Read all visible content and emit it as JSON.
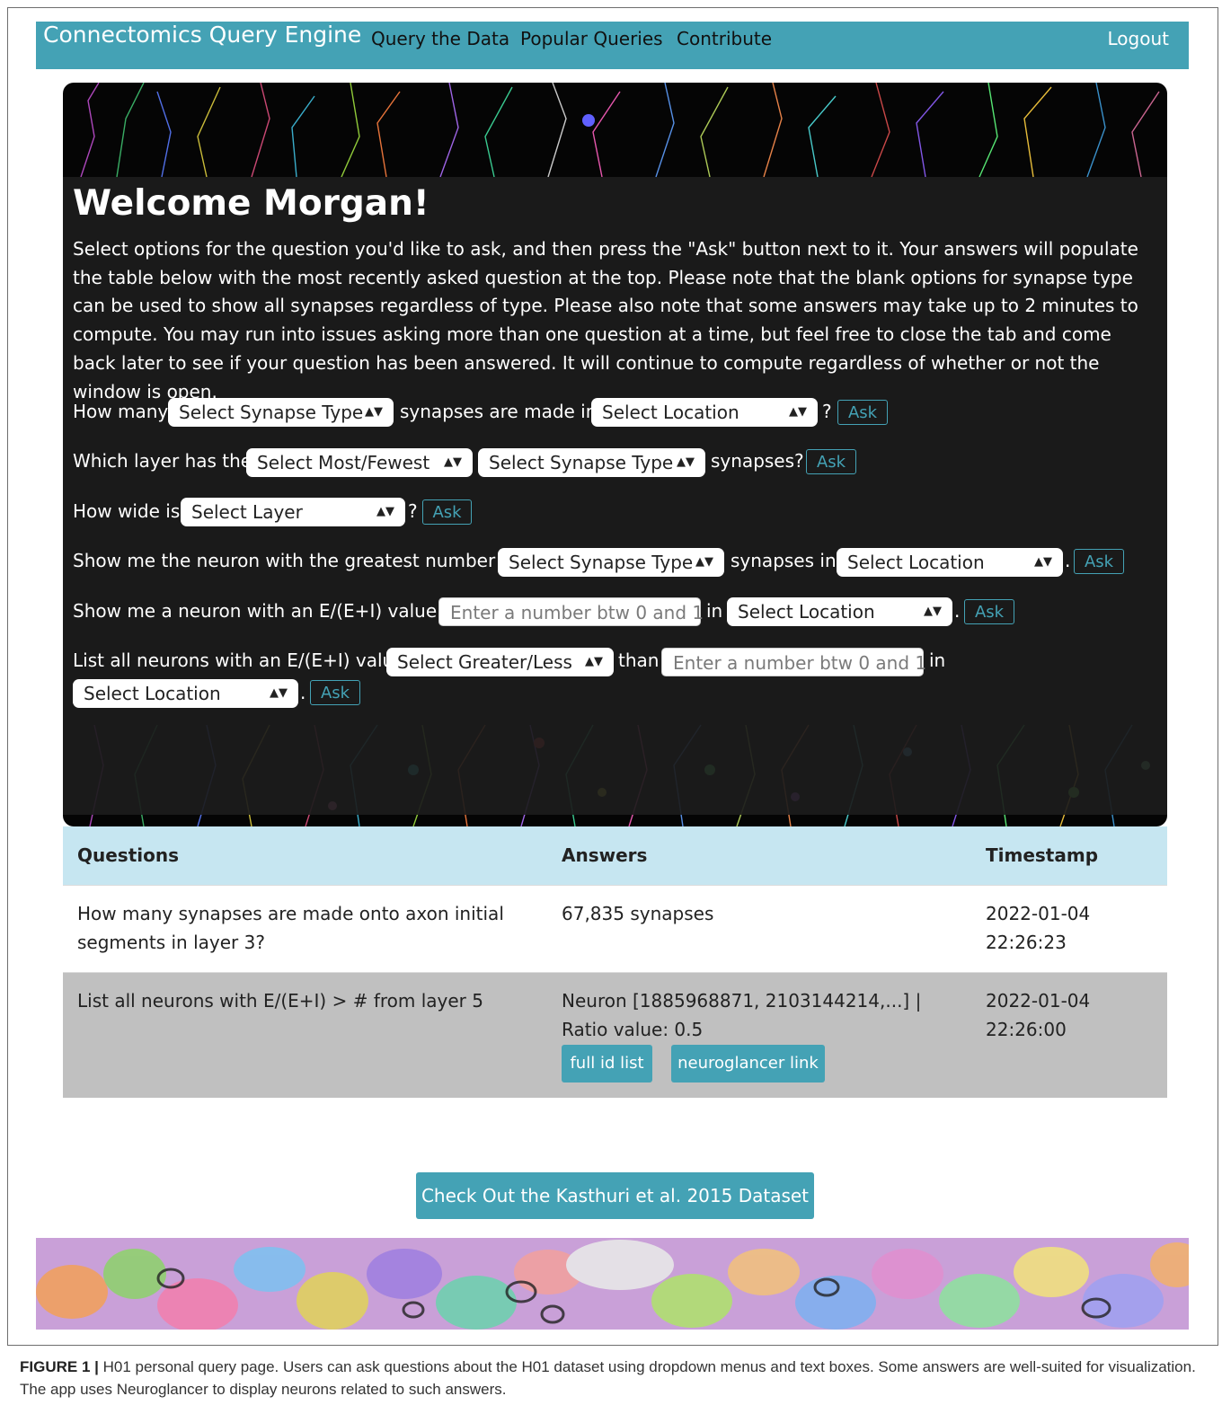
{
  "navbar": {
    "brand": "Connectomics Query Engine",
    "links": [
      "Query the Data",
      "Popular Queries",
      "Contribute"
    ],
    "logout": "Logout"
  },
  "hero": {
    "welcome": "Welcome Morgan!",
    "intro": "Select options for the question you'd like to ask, and then press the \"Ask\" button next to it. Your answers will populate the table below with the most recently asked question at the top. Please note that the blank options for synapse type can be used to show all synapses regardless of type. Please also note that some answers may take up to 2 minutes to compute. You may run into issues asking more than one question at a time, but feel free to close the tab and come back later to see if your question has been answered. It will continue to compute regardless of whether or not the window is open."
  },
  "queries": {
    "q1": {
      "prefix": "How many",
      "select1": "Select Synapse Type",
      "mid": "synapses are made in",
      "select2": "Select Location",
      "suffix": "?",
      "ask": "Ask"
    },
    "q2": {
      "prefix": "Which layer has the",
      "select1": "Select Most/Fewest",
      "select2": "Select Synapse Type",
      "suffix": "synapses?",
      "ask": "Ask"
    },
    "q3": {
      "prefix": "How wide is",
      "select1": "Select Layer",
      "suffix": "?",
      "ask": "Ask"
    },
    "q4": {
      "prefix": "Show me the neuron with the greatest number of",
      "select1": "Select Synapse Type",
      "mid": "synapses in",
      "select2": "Select Location",
      "suffix": ".",
      "ask": "Ask"
    },
    "q5": {
      "prefix": "Show me a neuron with an E/(E+I) value of",
      "input_placeholder": "Enter a number btw 0 and 1",
      "mid": "in",
      "select1": "Select Location",
      "suffix": ".",
      "ask": "Ask"
    },
    "q6": {
      "prefix": "List all neurons with an E/(E+I) value",
      "select1": "Select Greater/Less",
      "mid": "than",
      "input_placeholder": "Enter a number btw 0 and 1",
      "mid2": "in",
      "select2": "Select Location",
      "suffix": ".",
      "ask": "Ask"
    }
  },
  "table": {
    "headers": [
      "Questions",
      "Answers",
      "Timestamp"
    ],
    "rows": [
      {
        "question": "How many synapses are made onto axon initial segments in layer 3?",
        "answer": "67,835 synapses",
        "timestamp": "2022-01-04 22:26:23"
      },
      {
        "question": "List all neurons with E/(E+I) > # from layer 5",
        "answer": "Neuron [1885968871, 2103144214,...] | Ratio value: 0.5",
        "timestamp": "2022-01-04 22:26:00",
        "buttons": [
          "full id list",
          "neuroglancer link"
        ]
      }
    ]
  },
  "kasthuri_button": "Check Out the Kasthuri et al. 2015 Dataset",
  "caption": {
    "label": "FIGURE 1 |",
    "text": " H01 personal query page. Users can ask questions about the H01 dataset using dropdown menus and text boxes. Some answers are well-suited for visualization. The app uses Neuroglancer to display neurons related to such answers."
  },
  "colors": {
    "accent": "#44a2b5",
    "table_header": "#c6e6f1",
    "row_alt": "#c0c0c0",
    "hero_panel": "#1c1c1c"
  },
  "icons": [
    "select-arrows-icon"
  ]
}
